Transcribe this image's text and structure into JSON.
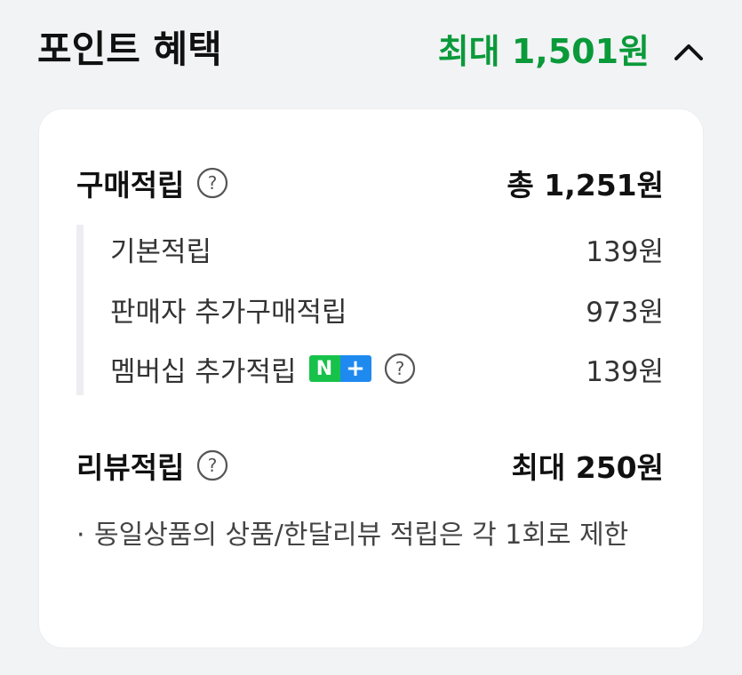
{
  "header": {
    "title": "포인트 혜택",
    "max_benefit": "최대 1,501원",
    "collapse_icon": "chevron-up-icon"
  },
  "purchase": {
    "title": "구매적립",
    "help_icon": "question-circle-icon",
    "total": "총 1,251원",
    "items": [
      {
        "label": "기본적립",
        "amount": "139원"
      },
      {
        "label": "판매자 추가구매적립",
        "amount": "973원"
      },
      {
        "label": "멤버십 추가적립",
        "amount": "139원",
        "badge_n": "N",
        "badge_plus": "+"
      }
    ]
  },
  "review": {
    "title": "리뷰적립",
    "help_icon": "question-circle-icon",
    "amount": "최대 250원",
    "notice_bullet": "·",
    "notice": "동일상품의 상품/한달리뷰 적립은 각 1회로 제한"
  },
  "colors": {
    "accent_green": "#0a9a3a",
    "badge_green": "#17c24a",
    "badge_blue": "#1e8af0",
    "background": "#f2f3f5",
    "card": "#ffffff"
  }
}
